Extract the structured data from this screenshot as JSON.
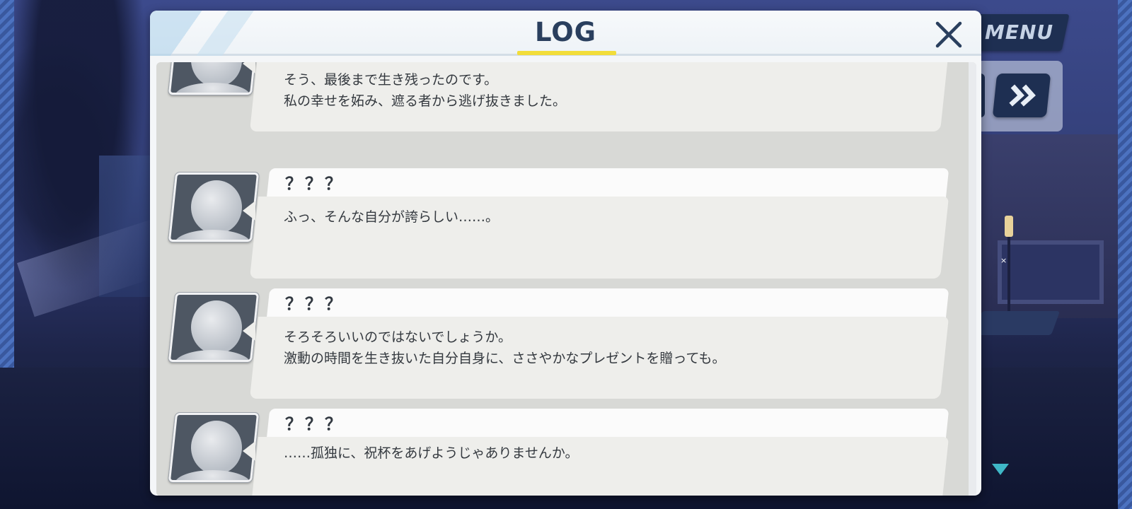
{
  "header": {
    "title": "LOG"
  },
  "hud": {
    "menu_label": "MENU",
    "skip_label": "»",
    "marker": "×"
  },
  "log": [
    {
      "speaker": "？？？",
      "lines": [
        "そう、最後まで生き残ったのです。",
        "私の幸せを妬み、遮る者から逃げ抜きました。"
      ]
    },
    {
      "speaker": "？？？",
      "lines": [
        "ふっ、そんな自分が誇らしい……。"
      ]
    },
    {
      "speaker": "？？？",
      "lines": [
        "そろそろいいのではないでしょうか。",
        "激動の時間を生き抜いた自分自身に、ささやかなプレゼントを贈っても。"
      ]
    },
    {
      "speaker": "？？？",
      "lines": [
        "……孤独に、祝杯をあげようじゃありませんか。"
      ]
    }
  ],
  "colors": {
    "accent_underline": "#f2dd3a",
    "panel_bg": "#f4f6f8",
    "navy": "#1e2f52",
    "down_arrow": "#3fb7c7"
  }
}
